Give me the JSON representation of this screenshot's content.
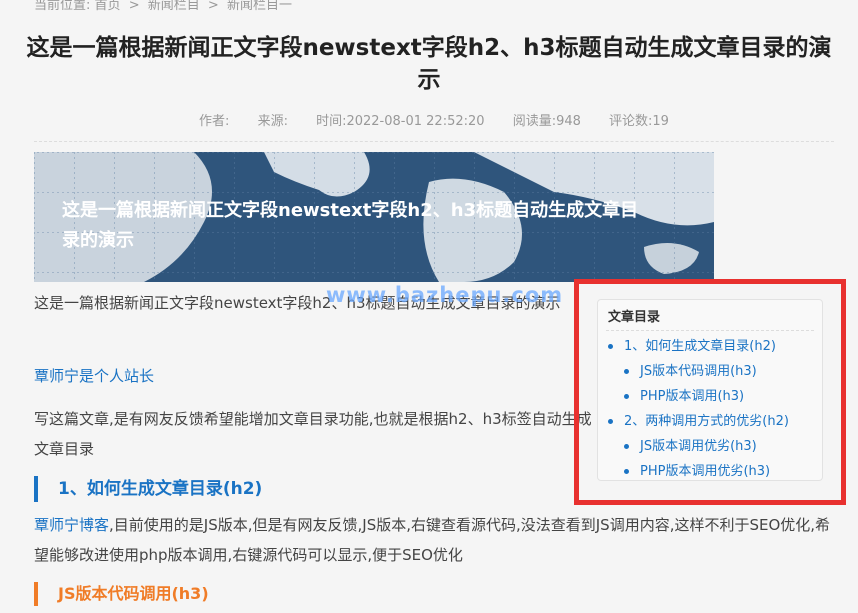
{
  "breadcrumb": {
    "label": "当前位置:",
    "items": [
      "首页",
      "新闻栏目",
      "新闻栏目一"
    ],
    "separator": ">"
  },
  "article": {
    "title": "这是一篇根据新闻正文字段newstext字段h2、h3标题自动生成文章目录的演示",
    "meta": {
      "author": "作者:",
      "source": "来源:",
      "time": "时间:2022-08-01 22:52:20",
      "views": "阅读量:948",
      "comments": "评论数:19"
    },
    "banner_text": "这是一篇根据新闻正文字段newstext字段h2、h3标题自动生成文章目录的演示",
    "intro": "这是一篇根据新闻正文字段newstext字段h2、h3标题自动生成文章目录的演示",
    "author_link": "覃师宁是个人站长",
    "para2": "写这篇文章,是有网友反馈希望能增加文章目录功能,也就是根据h2、h3标签自动生成文章目录",
    "h2_1": "1、如何生成文章目录(h2)",
    "para3_link": "覃师宁博客",
    "para3": ",目前使用的是JS版本,但是有网友反馈,JS版本,右键查看源代码,没法查看到JS调用内容,这样不利于SEO优化,希望能够改进使用php版本调用,右键源代码可以显示,便于SEO优化",
    "h3_1": "JS版本代码调用(h3)"
  },
  "watermark": "www.bazhepu.com",
  "toc": {
    "title": "文章目录",
    "items": [
      {
        "label": "1、如何生成文章目录(h2)",
        "level": 2
      },
      {
        "label": "JS版本代码调用(h3)",
        "level": 3
      },
      {
        "label": "PHP版本调用(h3)",
        "level": 3
      },
      {
        "label": "2、两种调用方式的优劣(h2)",
        "level": 2
      },
      {
        "label": "JS版本调用优劣(h3)",
        "level": 3
      },
      {
        "label": "PHP版本调用优劣(h3)",
        "level": 3
      }
    ]
  },
  "colors": {
    "accent_blue": "#1a73c4",
    "accent_orange": "#f07c27",
    "highlight_red": "#e8312f",
    "banner_bg": "#2f557c"
  }
}
